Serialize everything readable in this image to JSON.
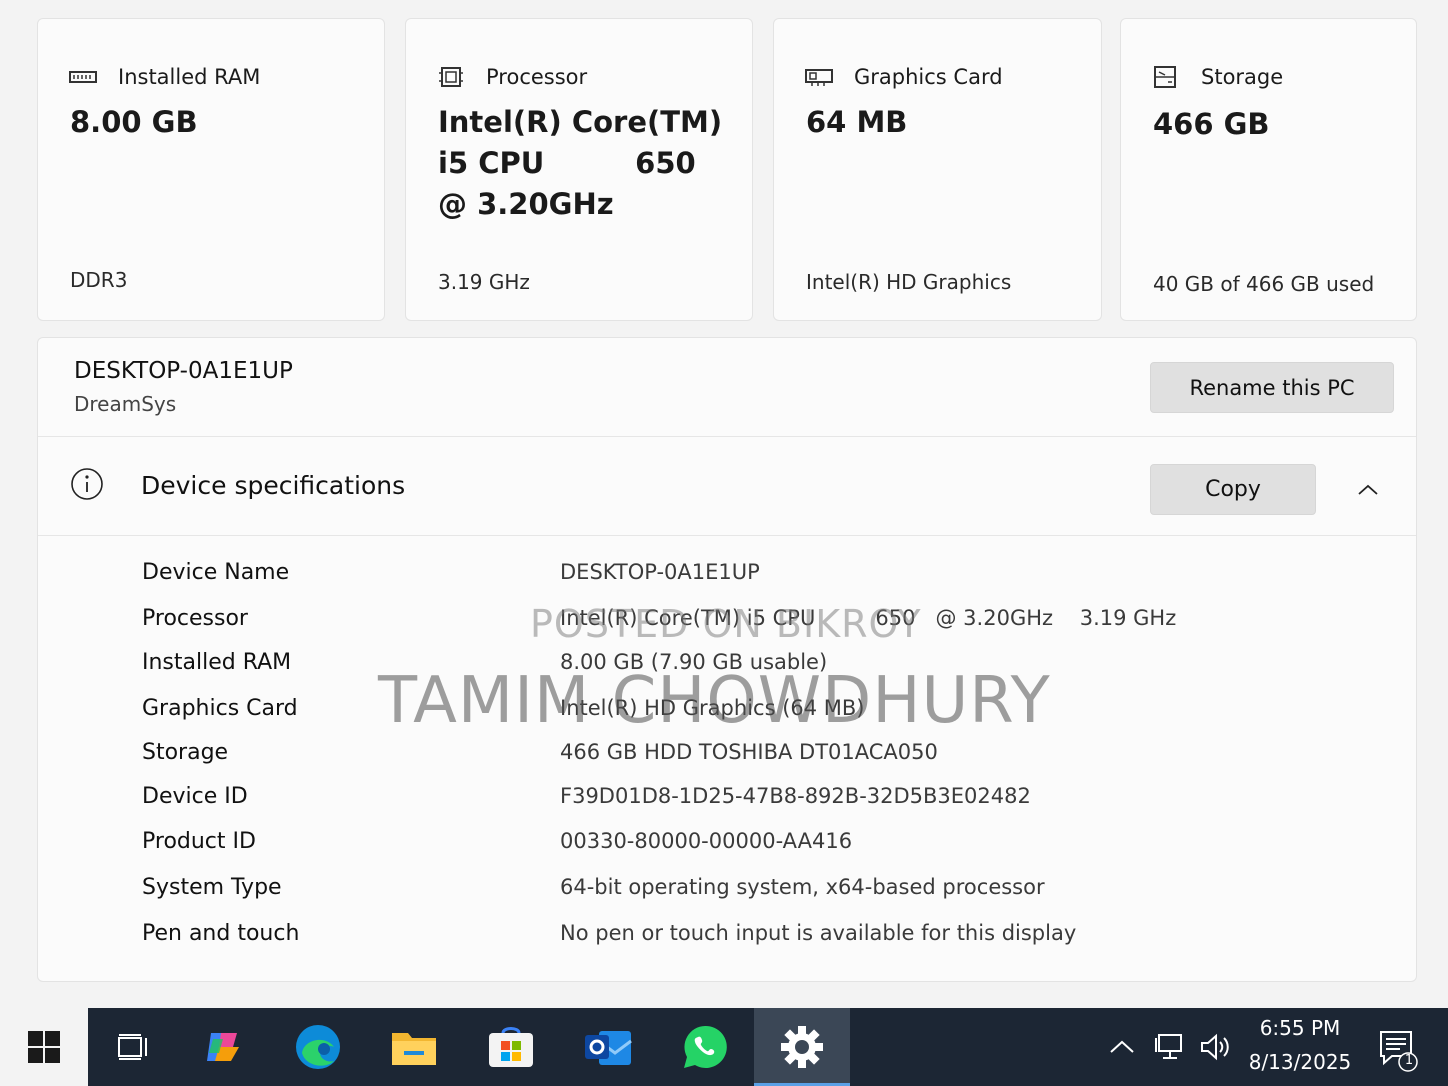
{
  "cards": {
    "ram": {
      "label": "Installed RAM",
      "value": "8.00 GB",
      "sub": "DDR3"
    },
    "cpu": {
      "label": "Processor",
      "value_line1": "Intel(R) Core(TM)",
      "value_line2": "i5 CPU         650",
      "value_line3": "@ 3.20GHz",
      "sub": "3.19 GHz"
    },
    "gpu": {
      "label": "Graphics Card",
      "value": "64 MB",
      "sub": "Intel(R) HD Graphics"
    },
    "storage": {
      "label": "Storage",
      "value": "466 GB",
      "sub": "40 GB of 466 GB used"
    }
  },
  "pc": {
    "name": "DESKTOP-0A1E1UP",
    "model": "DreamSys",
    "rename_label": "Rename this PC"
  },
  "specs": {
    "title": "Device specifications",
    "copy_label": "Copy",
    "rows": [
      {
        "key": "Device Name",
        "value": "DESKTOP-0A1E1UP"
      },
      {
        "key": "Processor",
        "value": "Intel(R) Core(TM) i5 CPU         650   @ 3.20GHz    3.19 GHz"
      },
      {
        "key": "Installed RAM",
        "value": "8.00 GB (7.90 GB usable)"
      },
      {
        "key": "Graphics Card",
        "value": "Intel(R) HD Graphics (64 MB)"
      },
      {
        "key": "Storage",
        "value": "466 GB HDD TOSHIBA DT01ACA050"
      },
      {
        "key": "Device ID",
        "value": "F39D01D8-1D25-47B8-892B-32D5B3E02482"
      },
      {
        "key": "Product ID",
        "value": "00330-80000-00000-AA416"
      },
      {
        "key": "System Type",
        "value": "64-bit operating system, x64-based processor"
      },
      {
        "key": "Pen and touch",
        "value": "No pen or touch input is available for this display"
      }
    ]
  },
  "watermark": {
    "line1": "POSTED ON BIKROY",
    "line2": "TAMIM CHOWDHURY"
  },
  "taskbar": {
    "apps": [
      "start-icon",
      "task-view-icon",
      "copilot-icon",
      "edge-icon",
      "file-explorer-icon",
      "store-icon",
      "outlook-icon",
      "whatsapp-icon",
      "settings-icon"
    ],
    "active_app": "settings-icon",
    "time": "6:55 PM",
    "date": "8/13/2025",
    "notification_count": "1"
  },
  "colors": {
    "taskbar_bg": "#1c2634",
    "accent": "#5aa0e6",
    "button_bg": "#e0e0e0"
  }
}
